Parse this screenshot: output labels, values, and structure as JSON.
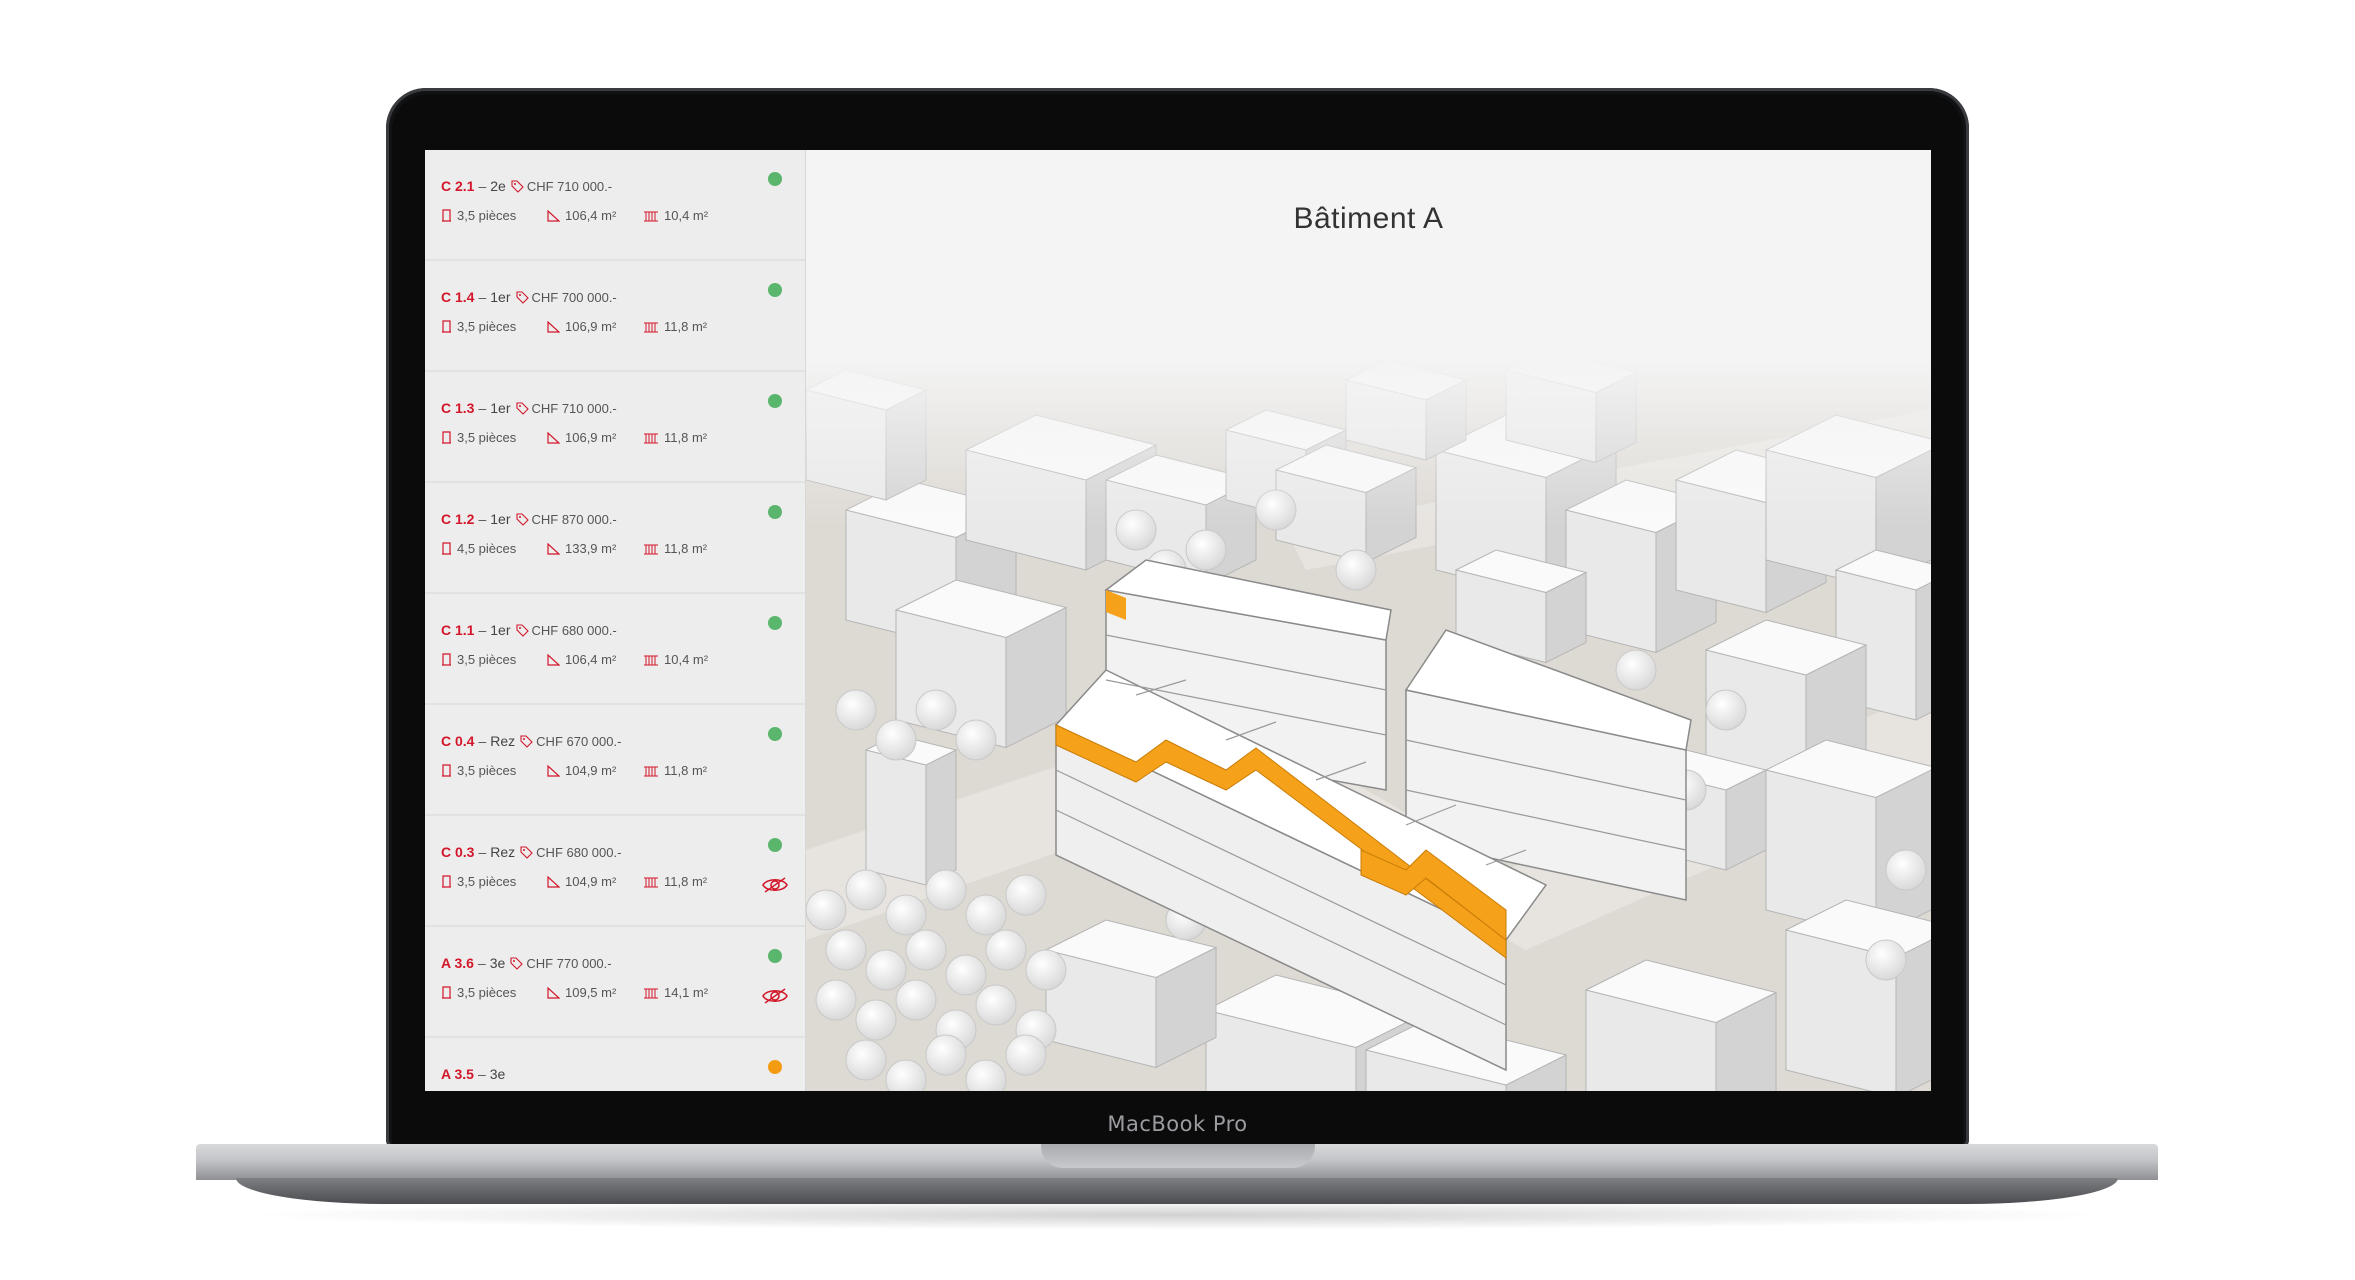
{
  "device": {
    "label": "MacBook Pro"
  },
  "map": {
    "title": "Bâtiment A"
  },
  "colors": {
    "available": "#5bb66d",
    "reserved": "#f39c12",
    "accent": "#d3172b",
    "highlight": "#f5a11a"
  },
  "units": [
    {
      "id": "C 2.1",
      "floor": "2e",
      "price": "CHF 710 000.-",
      "rooms": "3,5 pièces",
      "area": "106,4 m²",
      "balcony": "10,4 m²",
      "status": "available",
      "viewable": false
    },
    {
      "id": "C 1.4",
      "floor": "1er",
      "price": "CHF 700 000.-",
      "rooms": "3,5 pièces",
      "area": "106,9 m²",
      "balcony": "11,8 m²",
      "status": "available",
      "viewable": false
    },
    {
      "id": "C 1.3",
      "floor": "1er",
      "price": "CHF 710 000.-",
      "rooms": "3,5 pièces",
      "area": "106,9 m²",
      "balcony": "11,8 m²",
      "status": "available",
      "viewable": false
    },
    {
      "id": "C 1.2",
      "floor": "1er",
      "price": "CHF 870 000.-",
      "rooms": "4,5 pièces",
      "area": "133,9 m²",
      "balcony": "11,8 m²",
      "status": "available",
      "viewable": false
    },
    {
      "id": "C 1.1",
      "floor": "1er",
      "price": "CHF 680 000.-",
      "rooms": "3,5 pièces",
      "area": "106,4 m²",
      "balcony": "10,4 m²",
      "status": "available",
      "viewable": false
    },
    {
      "id": "C 0.4",
      "floor": "Rez",
      "price": "CHF 670 000.-",
      "rooms": "3,5 pièces",
      "area": "104,9 m²",
      "balcony": "11,8 m²",
      "status": "available",
      "viewable": false
    },
    {
      "id": "C 0.3",
      "floor": "Rez",
      "price": "CHF 680 000.-",
      "rooms": "3,5 pièces",
      "area": "104,9 m²",
      "balcony": "11,8 m²",
      "status": "available",
      "viewable": true
    },
    {
      "id": "A 3.6",
      "floor": "3e",
      "price": "CHF 770 000.-",
      "rooms": "3,5 pièces",
      "area": "109,5 m²",
      "balcony": "14,1 m²",
      "status": "available",
      "viewable": true
    },
    {
      "id": "A 3.5",
      "floor": "3e",
      "price": "",
      "rooms": "",
      "area": "",
      "balcony": "",
      "status": "reserved",
      "viewable": false
    }
  ]
}
